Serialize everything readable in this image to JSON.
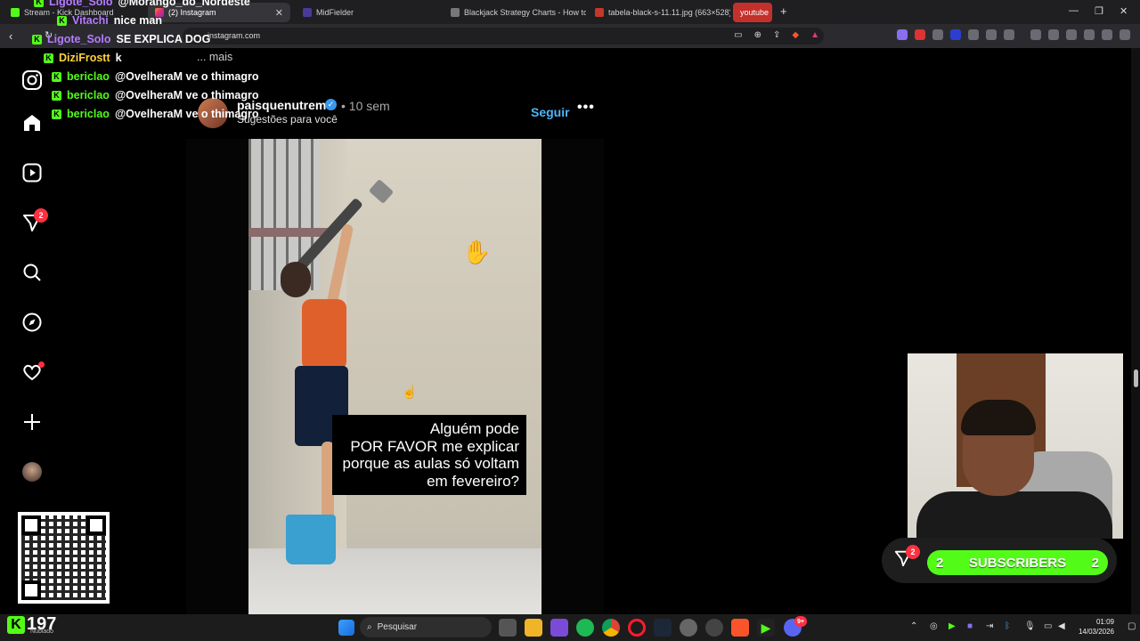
{
  "browser": {
    "tabs": [
      {
        "label": "Stream - Kick Dashboard",
        "active": false
      },
      {
        "label": "(2) Instagram",
        "active": true
      },
      {
        "label": "MidFielder",
        "active": false
      },
      {
        "label": "Blackjack Strategy Charts - How to Pl",
        "active": false
      },
      {
        "label": "tabela-black-s-11.11.jpg (663×528)",
        "active": false
      },
      {
        "label": "youtube",
        "active": false
      }
    ],
    "new_tab": "+",
    "url": "instagram.com"
  },
  "instagram": {
    "notification_count": "2",
    "post": {
      "username": "paisquenutrem",
      "verified": "✓",
      "time": "• 10 sem",
      "subtitle": "Sugestões para você",
      "follow_label": "Seguir",
      "more_label": "•••",
      "video_caption_lines": [
        "Alguém pode",
        "POR FAVOR me explicar",
        "porque as aulas só voltam",
        "em fevereiro?"
      ]
    }
  },
  "chat": {
    "messages": [
      {
        "user": "Ligote_Solo",
        "text": "@Morango_do_Nordeste",
        "color": "#b57bff"
      },
      {
        "user": "Vitachi",
        "text": "nice man",
        "color": "#b57bff"
      },
      {
        "user": "Ligote_Solo",
        "text": "SE EXPLICA DOG",
        "color": "#b57bff"
      },
      {
        "user": "DiziFrostt",
        "text": "k",
        "color": "#ffd23f"
      },
      {
        "user": "bericlao",
        "text": "@OvelheraM ve o thimagro",
        "color": "#53fc18"
      },
      {
        "user": "bericlao",
        "text": "@OvelheraM ve o thimagro",
        "color": "#53fc18"
      },
      {
        "user": "bericlao",
        "text": "@OvelheraM ve o thimagro",
        "color": "#53fc18"
      }
    ],
    "more_label": "... mais"
  },
  "overlay": {
    "subscribers_label": "SUBSCRIBERS",
    "subscribers_left": "2",
    "subscribers_right": "2",
    "gift_badge": "2"
  },
  "taskbar": {
    "kick_count": "197",
    "kick_sub": "Nublado",
    "search_placeholder": "Pesquisar",
    "time": "01:09",
    "date": "14/03/2026",
    "discord_badge": "9+"
  },
  "colors": {
    "kick_green": "#53fc18",
    "instagram_blue": "#4cb5f9",
    "notification_red": "#ff3040"
  }
}
